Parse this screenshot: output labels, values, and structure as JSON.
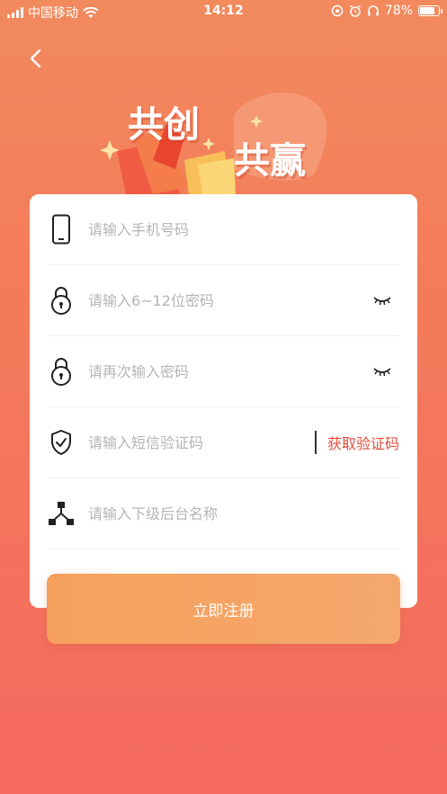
{
  "status_bar": {
    "carrier": "中国移动",
    "time": "14:12",
    "battery": "78%",
    "battery_level": 0.78
  },
  "banner": {
    "title_line1": "共创",
    "title_line2": "共赢"
  },
  "form": {
    "phone_placeholder": "请输入手机号码",
    "password_placeholder": "请输入6~12位密码",
    "confirm_placeholder": "请再次输入密码",
    "sms_placeholder": "请输入短信验证码",
    "get_code_label": "获取验证码",
    "sub_placeholder": "请输入下级后台名称"
  },
  "submit_label": "立即注册",
  "colors": {
    "accent": "#e04f3c",
    "button": "#f5a566"
  },
  "icons": {
    "back": "chevron-left-icon",
    "phone": "phone-icon",
    "lock": "lock-icon",
    "shield": "shield-check-icon",
    "hierarchy": "hierarchy-icon",
    "eye_closed": "eye-closed-icon"
  }
}
